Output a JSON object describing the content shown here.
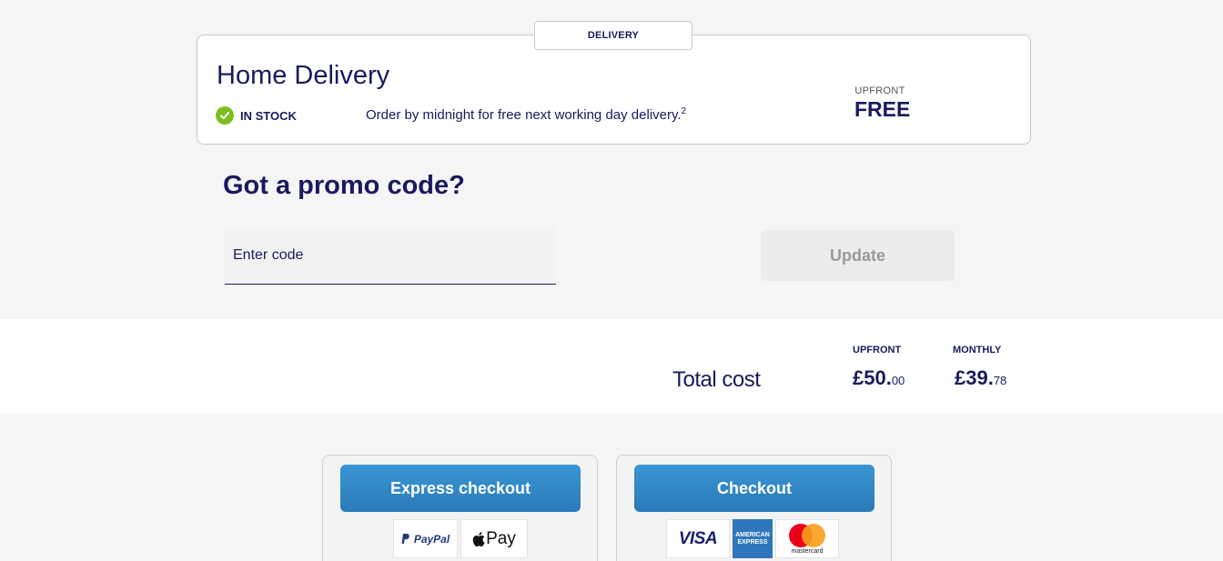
{
  "delivery": {
    "tab_label": "DELIVERY",
    "title": "Home Delivery",
    "stock_status": "IN STOCK",
    "note": "Order by midnight for free next working day delivery.",
    "note_footnote": "2",
    "upfront_label": "UPFRONT",
    "upfront_value": "FREE"
  },
  "promo": {
    "title": "Got a promo code?",
    "placeholder": "Enter code",
    "update_label": "Update"
  },
  "total": {
    "label": "Total cost",
    "upfront_label": "UPFRONT",
    "upfront_major": "£50.",
    "upfront_minor": "00",
    "monthly_label": "MONTHLY",
    "monthly_major": "£39.",
    "monthly_minor": "78"
  },
  "checkout": {
    "express_label": "Express checkout",
    "checkout_label": "Checkout",
    "express_methods": [
      "PayPal",
      "Pay"
    ],
    "card_methods": [
      "VISA",
      "AMERICAN EXPRESS",
      "mastercard"
    ]
  },
  "colors": {
    "brand_navy": "#1a1a5e",
    "cta_blue": "#2a7bb8",
    "in_stock_green": "#7cbf1f"
  }
}
